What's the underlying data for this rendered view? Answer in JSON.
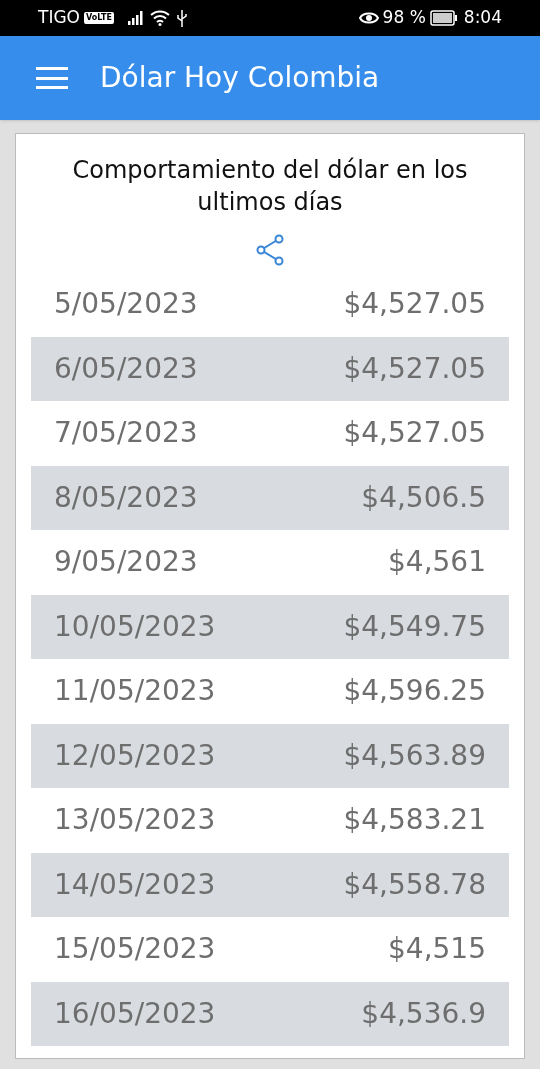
{
  "status_bar": {
    "carrier": "TIGO",
    "network_badge": "VoLTE",
    "battery": "98 %",
    "time": "8:04"
  },
  "app_bar": {
    "title": "Dólar Hoy Colombia"
  },
  "card": {
    "title": "Comportamiento del dólar en los ultimos días",
    "rows": [
      {
        "date": "5/05/2023",
        "price": "$4,527.05"
      },
      {
        "date": "6/05/2023",
        "price": "$4,527.05"
      },
      {
        "date": "7/05/2023",
        "price": "$4,527.05"
      },
      {
        "date": "8/05/2023",
        "price": "$4,506.5"
      },
      {
        "date": "9/05/2023",
        "price": "$4,561"
      },
      {
        "date": "10/05/2023",
        "price": "$4,549.75"
      },
      {
        "date": "11/05/2023",
        "price": "$4,596.25"
      },
      {
        "date": "12/05/2023",
        "price": "$4,563.89"
      },
      {
        "date": "13/05/2023",
        "price": "$4,583.21"
      },
      {
        "date": "14/05/2023",
        "price": "$4,558.78"
      },
      {
        "date": "15/05/2023",
        "price": "$4,515"
      },
      {
        "date": "16/05/2023",
        "price": "$4,536.9"
      }
    ]
  }
}
